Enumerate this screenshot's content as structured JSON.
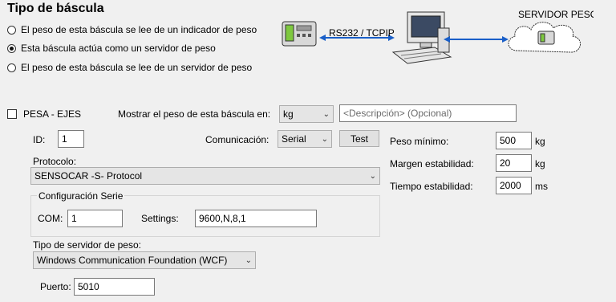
{
  "header": {
    "title": "Tipo de báscula"
  },
  "options": [
    {
      "label": "El peso de esta báscula se lee de un indicador de peso",
      "selected": false
    },
    {
      "label": "Esta báscula actúa como un servidor de peso",
      "selected": true
    },
    {
      "label": "El peso de esta báscula se lee de un servidor de peso",
      "selected": false
    }
  ],
  "diagram": {
    "link_label": "RS232 / TCPIP",
    "server_label": "SERVIDOR PESO"
  },
  "pesa_ejes": {
    "label": "PESA - EJES",
    "checked": false
  },
  "display_unit": {
    "label": "Mostrar el peso de esta báscula en:",
    "value": "kg"
  },
  "description": {
    "placeholder": "<Descripción> (Opcional)"
  },
  "id_field": {
    "label": "ID:",
    "value": "1"
  },
  "communication": {
    "label": "Comunicación:",
    "value": "Serial",
    "test_label": "Test"
  },
  "protocol": {
    "label": "Protocolo:",
    "value": "SENSOCAR -S- Protocol"
  },
  "serial_config": {
    "title": "Configuración Serie",
    "com_label": "COM:",
    "com_value": "1",
    "settings_label": "Settings:",
    "settings_value": "9600,N,8,1"
  },
  "server_type": {
    "label": "Tipo de servidor de peso:",
    "value": "Windows Communication Foundation (WCF)"
  },
  "port": {
    "label": "Puerto:",
    "value": "5010"
  },
  "weights": {
    "min": {
      "label": "Peso mínimo:",
      "value": "500",
      "unit": "kg"
    },
    "margin": {
      "label": "Margen estabilidad:",
      "value": "20",
      "unit": "kg"
    },
    "time": {
      "label": "Tiempo estabilidad:",
      "value": "2000",
      "unit": "ms"
    }
  }
}
